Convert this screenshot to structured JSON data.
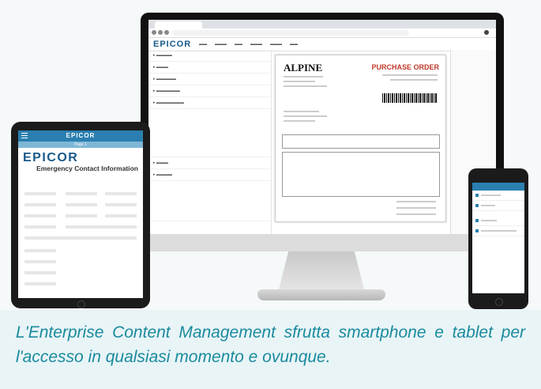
{
  "caption": "L'Enterprise Content Management sfrutta smartphone e tablet per l'accesso in qualsiasi momento e ovunque.",
  "monitor": {
    "brand_logo": "EPICOR",
    "document_company": "ALPINE",
    "document_title": "PURCHASE ORDER"
  },
  "tablet": {
    "header_logo": "EPICOR",
    "sub_label": "Page 1",
    "brand_logo": "EPICOR",
    "form_title": "Emergency Contact Information"
  },
  "colors": {
    "caption": "#1a8a9e",
    "brand_blue": "#2a7fb0",
    "po_red": "#c0392b"
  }
}
